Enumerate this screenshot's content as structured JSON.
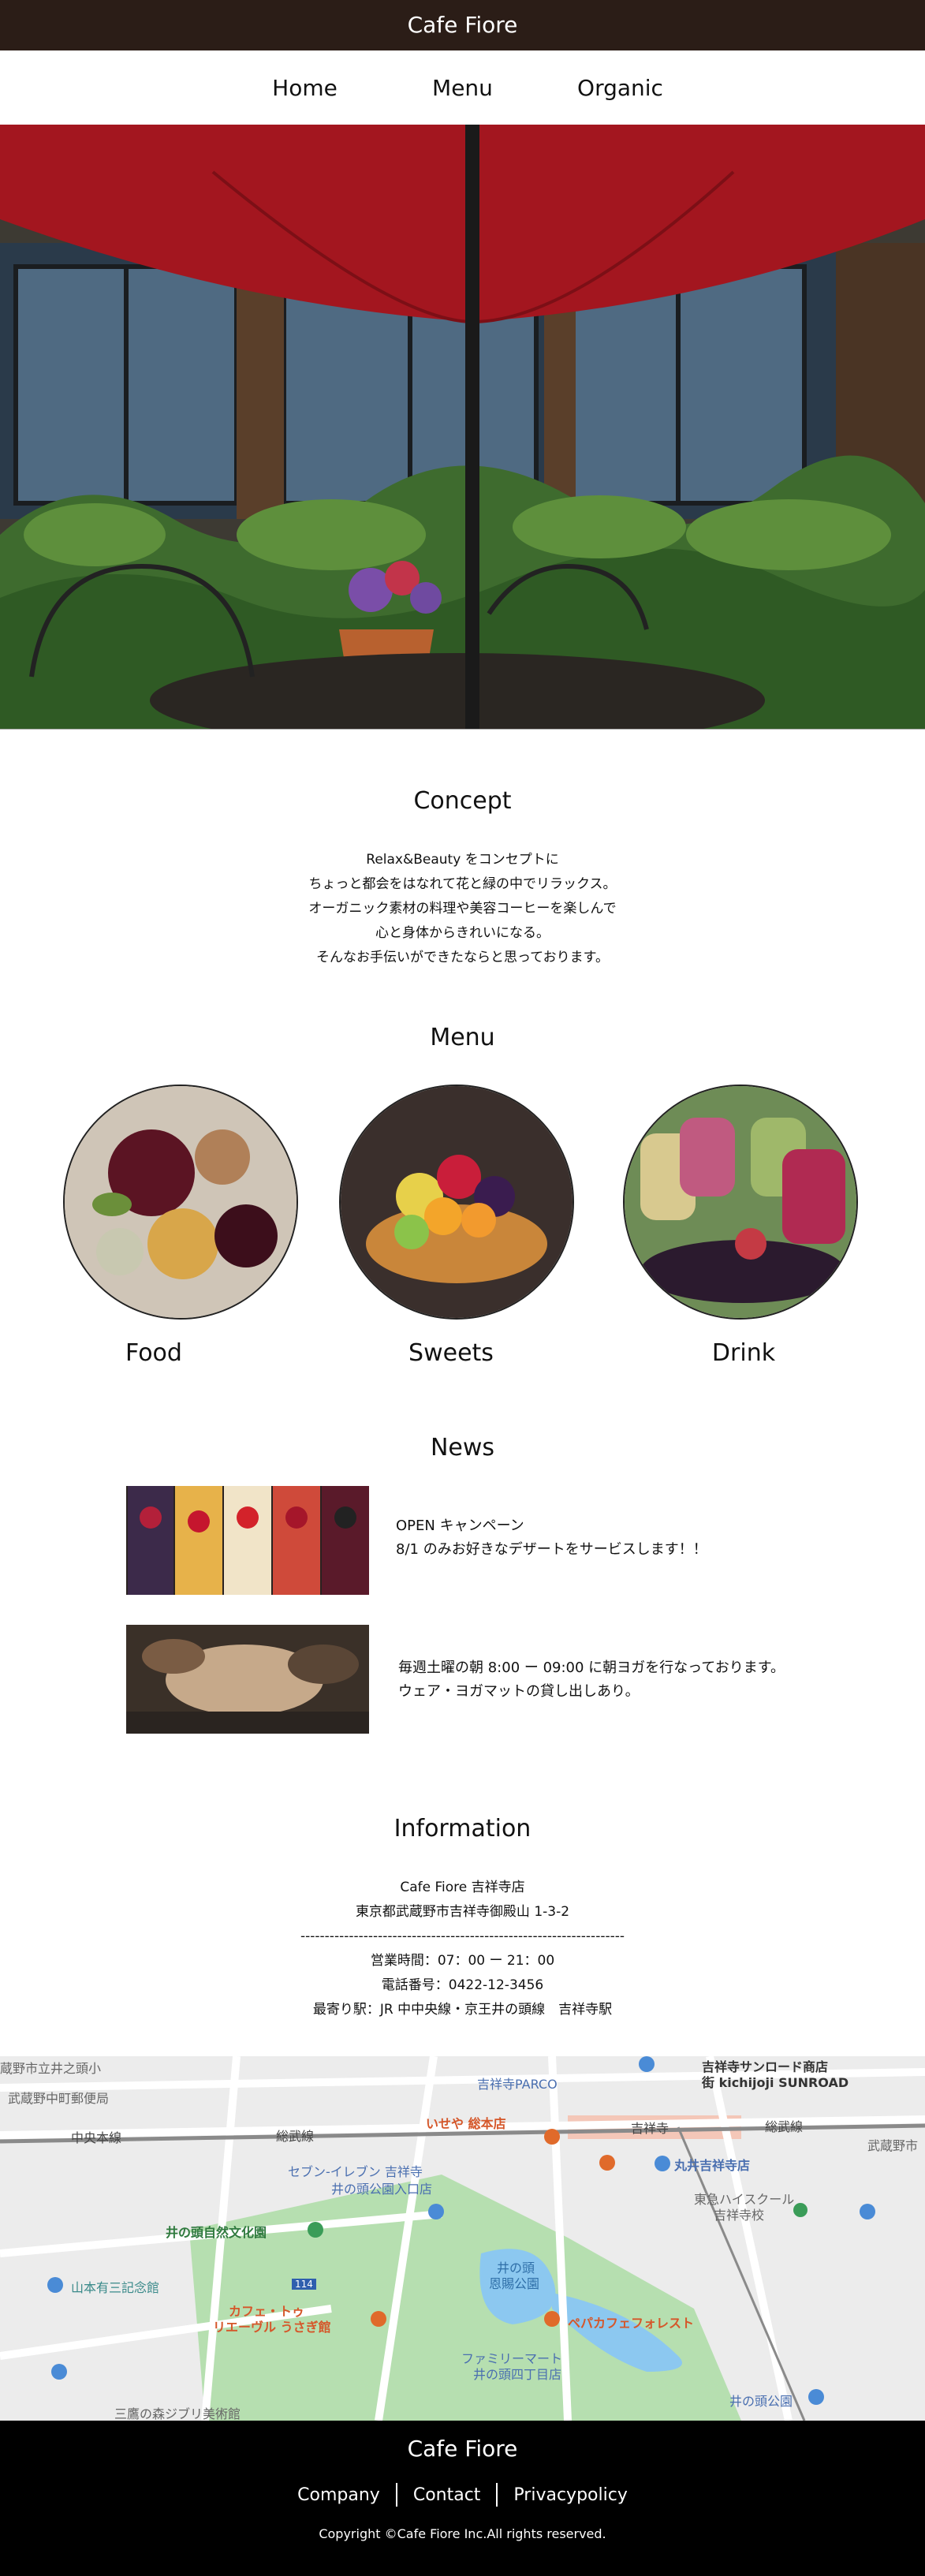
{
  "header": {
    "site_title": "Cafe Fiore",
    "nav": [
      "Home",
      "Menu",
      "Organic"
    ]
  },
  "concept": {
    "title": "Concept",
    "lines": [
      "Relax&Beauty をコンセプトに",
      "ちょっと都会をはなれて花と緑の中でリラックス。",
      "オーガニック素材の料理や美容コーヒーを楽しんで",
      "心と身体からきれいになる。",
      "そんなお手伝いができたならと思っております。"
    ]
  },
  "menu": {
    "title": "Menu",
    "items": [
      "Food",
      "Sweets",
      "Drink"
    ]
  },
  "news": {
    "title": "News",
    "items": [
      {
        "lines": [
          "OPEN キャンペーン",
          "8/1 のみお好きなデザートをサービスします！！"
        ]
      },
      {
        "lines": [
          "毎週土曜の朝 8:00 ー 09:00 に朝ヨガを行なっております。",
          "ウェア・ヨガマットの貸し出しあり。"
        ]
      }
    ]
  },
  "information": {
    "title": "Information",
    "lines": [
      "Cafe Fiore 吉祥寺店",
      "東京都武蔵野市吉祥寺御殿山 1-3-2",
      "-------------------------------------------------------------------",
      "営業時間：07：00 ー 21：00",
      "電話番号：0422-12-3456",
      "最寄り駅：JR 中中央線・京王井の頭線　吉祥寺駅"
    ]
  },
  "map": {
    "labels": [
      "蔵野市立井之頭小",
      "武蔵野中町郵便局",
      "中央本線",
      "総武線",
      "吉祥寺PARCO",
      "吉祥寺サンロード商店",
      "街 kichijoji SUNROAD",
      "吉祥寺",
      "総武線",
      "いせや 総本店",
      "セブン-イレブン 吉祥寺",
      "井の頭公園入口店",
      "丸井吉祥寺店",
      "東急ハイスクール",
      "吉祥寺校",
      "武蔵野市",
      "井の頭自然文化園",
      "井の頭",
      "恩賜公園",
      "山本有三記念館",
      "カフェ・トゥ",
      "リエーヴル うさぎ館",
      "ペパカフェフォレスト",
      "ファミリーマート",
      "井の頭四丁目店",
      "三鷹の森ジブリ美術館",
      "井の頭公園",
      "114"
    ],
    "colors": {
      "park": "#b6dfb0",
      "water": "#8cc8f0",
      "road": "#ffffff",
      "base": "#ececec",
      "poi": "#e06a2b",
      "rail": "#4a8bd6"
    }
  },
  "footer": {
    "title": "Cafe Fiore",
    "links": [
      "Company",
      "Contact",
      "Privacypolicy"
    ],
    "copyright": "Copyright ©Cafe Fiore Inc.All rights reserved."
  }
}
